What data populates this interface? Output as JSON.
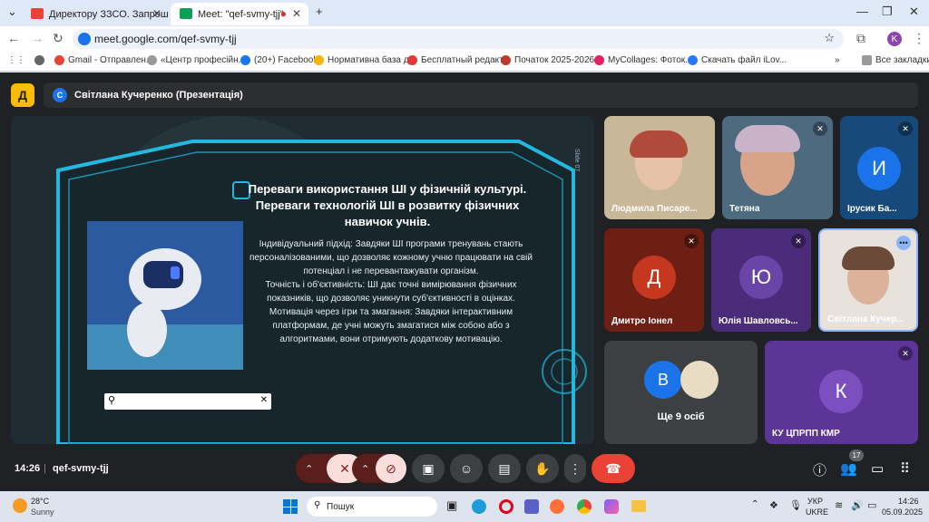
{
  "browser": {
    "tabs": [
      {
        "title": "Директору ЗЗСО. Запрошення"
      },
      {
        "title": "Meet: \"qef-svmy-tjj\""
      }
    ],
    "url": "meet.google.com/qef-svmy-tjj",
    "profile_initial": "K",
    "bookmarks": [
      "Gmail - Отправлен...",
      "«Центр професійн...",
      "(20+) Facebook",
      "Нормативна база д...",
      "Бесплатный редакт...",
      "Початок 2025-2026...",
      "MyCollages: Фоток...",
      "Скачать файл iLov..."
    ],
    "all_bookmarks": "Все закладки"
  },
  "meet": {
    "presenter_initial": "С",
    "presenter_title": "Світлана Кучеренко (Презентація)",
    "slide": {
      "side_label": "Slide 07",
      "title": "Переваги використання ШІ у фізичній культурі. Переваги технологій ШІ в розвитку фізичних навичок учнів.",
      "paragraphs": [
        "Індивідуальний підхід: Завдяки ШІ програми тренувань стають персоналізованими, що дозволяє кожному учню працювати на свій потенціал і не перевантажувати організм.",
        "Точність і об'єктивність: ШІ дає точні вимірювання фізичних показників, що дозволяє уникнути суб'єктивності в оцінках.",
        "Мотивація через ігри та змагання: Завдяки інтерактивним платформам, де учні можуть змагатися між собою або з алгоритмами, вони отримують додаткову мотивацію."
      ]
    },
    "participants": [
      {
        "name": "Людмила Писаре..."
      },
      {
        "name": "Тетяна"
      },
      {
        "name": "Ірусик Ба...",
        "initial": "И"
      },
      {
        "name": "Дмитро Іонел",
        "initial": "Д"
      },
      {
        "name": "Юлія Шавловсь...",
        "initial": "Ю"
      },
      {
        "name": "Світлана Кучер..."
      },
      {
        "name": "Ще 9 осіб",
        "initial": "В"
      },
      {
        "name": "КУ ЦПРПП КМР",
        "initial": "К"
      }
    ],
    "time": "14:26",
    "meeting_code": "qef-svmy-tjj",
    "people_count": "17"
  },
  "taskbar": {
    "temp": "28°C",
    "weather": "Sunny",
    "search": "Пошук",
    "lang1": "УКР",
    "lang2": "UKRE",
    "time": "14:26",
    "date": "05.09.2025"
  },
  "colors": {
    "accent": "#1a73e8",
    "end_call": "#ea4335",
    "meet_bg": "#202124"
  }
}
